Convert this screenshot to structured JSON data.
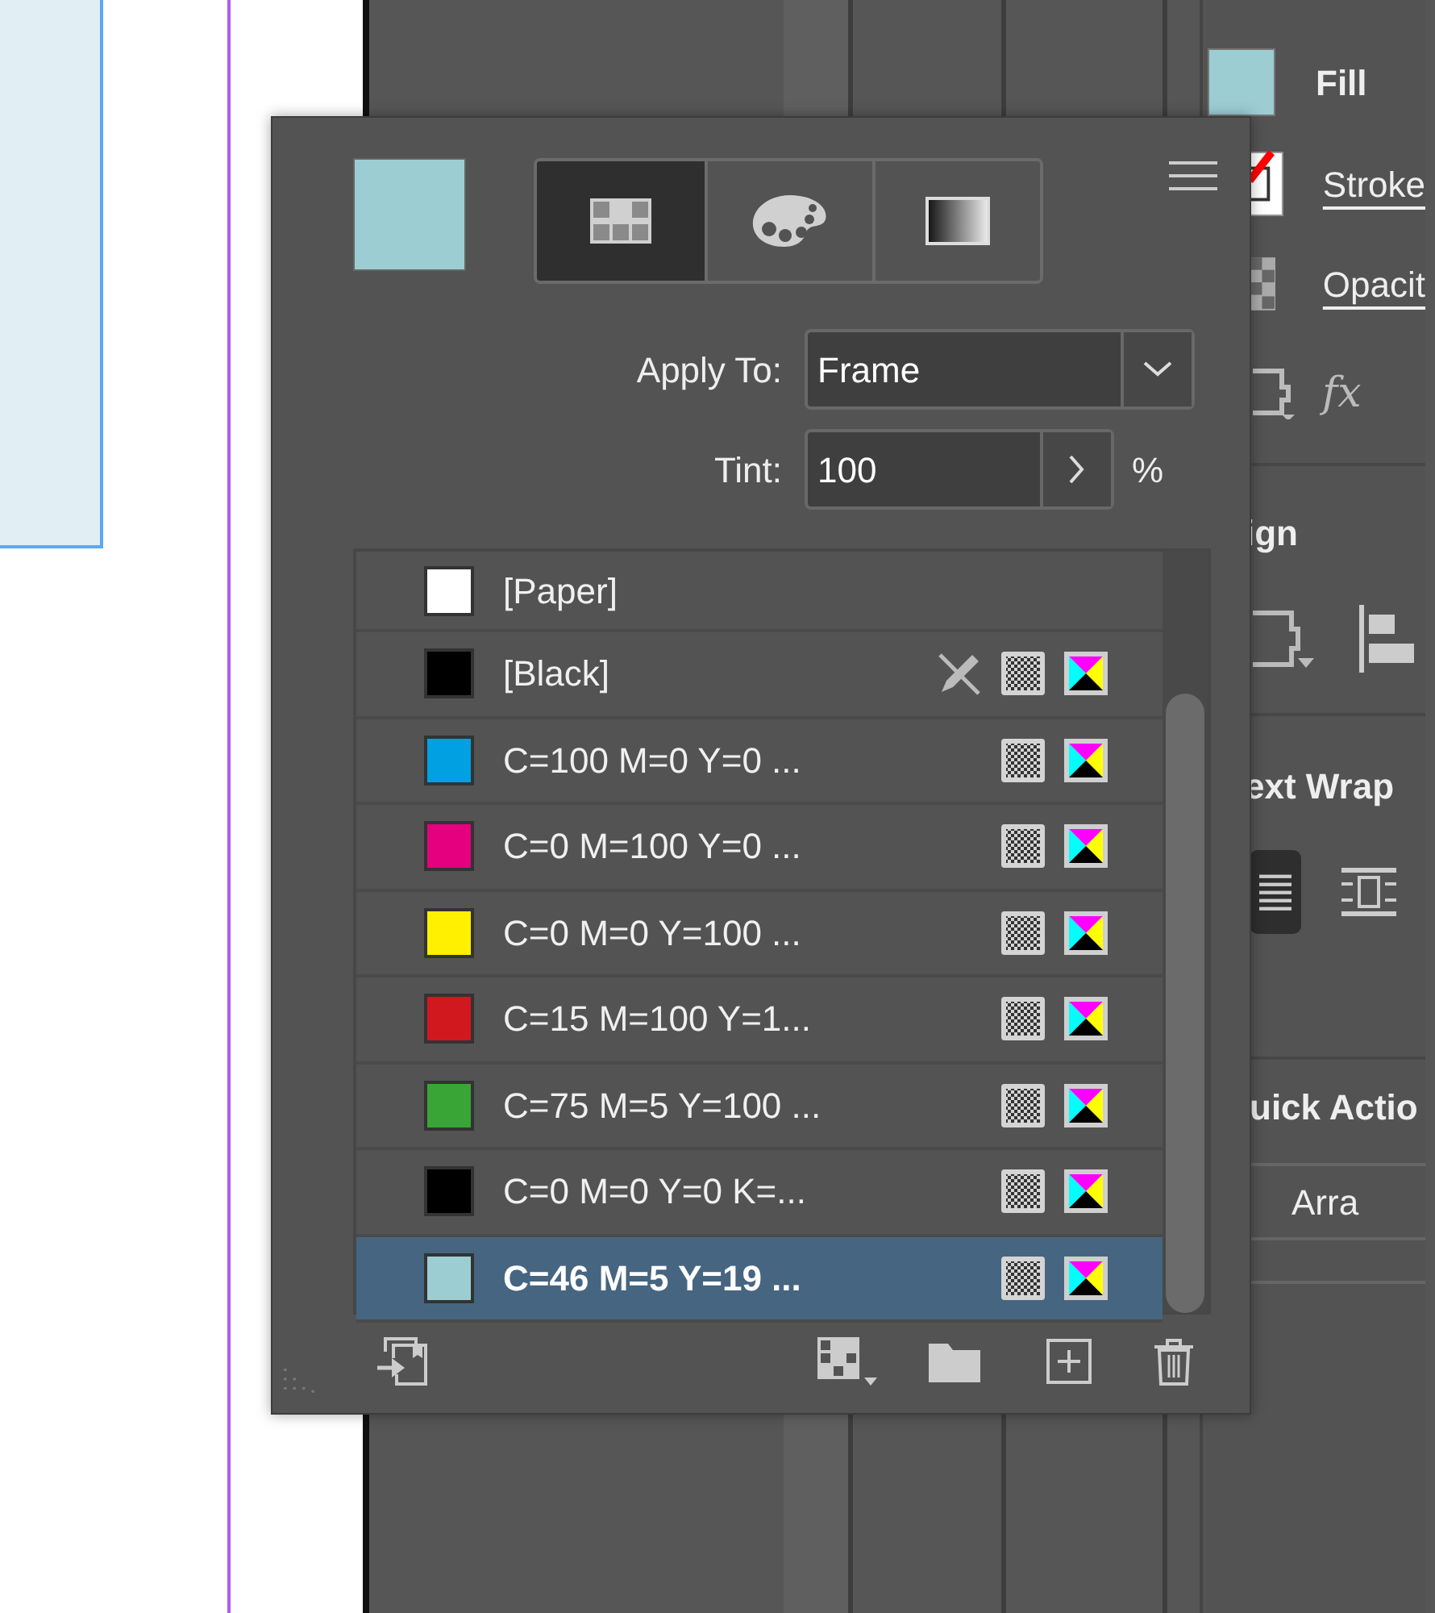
{
  "properties_panel": {
    "fill_label": "Fill",
    "stroke_label": "Stroke",
    "opacity_label": "Opacit",
    "effects_label": "fx",
    "align_heading": "ign",
    "text_wrap_heading": "ext Wrap",
    "wrap_options": [
      {
        "kind": "wrap-around",
        "selected": true
      },
      {
        "kind": "jump",
        "selected": false
      }
    ],
    "quick_actions_heading": "uick Actio",
    "arrange_button": "Arra"
  },
  "swatches_panel": {
    "view_tabs": [
      {
        "kind": "swatches",
        "selected": true
      },
      {
        "kind": "color",
        "selected": false
      },
      {
        "kind": "gradient",
        "selected": false
      }
    ],
    "apply_to": {
      "label": "Apply To:",
      "value": "Frame"
    },
    "tint": {
      "label": "Tint:",
      "value": "100",
      "unit": "%"
    },
    "swatches": [
      {
        "name": "[Paper]",
        "color": "#ffffff",
        "selected": false,
        "locked": false,
        "process": false
      },
      {
        "name": "[Black]",
        "color": "#000000",
        "selected": false,
        "locked": true,
        "process": true
      },
      {
        "name": "C=100 M=0 Y=0 ...",
        "color": "#00a0e3",
        "selected": false,
        "locked": false,
        "process": true
      },
      {
        "name": "C=0 M=100 Y=0 ...",
        "color": "#e4007f",
        "selected": false,
        "locked": false,
        "process": true
      },
      {
        "name": "C=0 M=0 Y=100 ...",
        "color": "#fff000",
        "selected": false,
        "locked": false,
        "process": true
      },
      {
        "name": "C=15 M=100 Y=1...",
        "color": "#d2181f",
        "selected": false,
        "locked": false,
        "process": true
      },
      {
        "name": "C=75 M=5 Y=100 ...",
        "color": "#3aa537",
        "selected": false,
        "locked": false,
        "process": true
      },
      {
        "name": "C=0 M=0 Y=0 K=...",
        "color": "#000000",
        "selected": false,
        "locked": false,
        "process": true
      },
      {
        "name": "C=46 M=5 Y=19 ...",
        "color": "#9ccdd3",
        "selected": true,
        "locked": false,
        "process": true
      }
    ]
  }
}
